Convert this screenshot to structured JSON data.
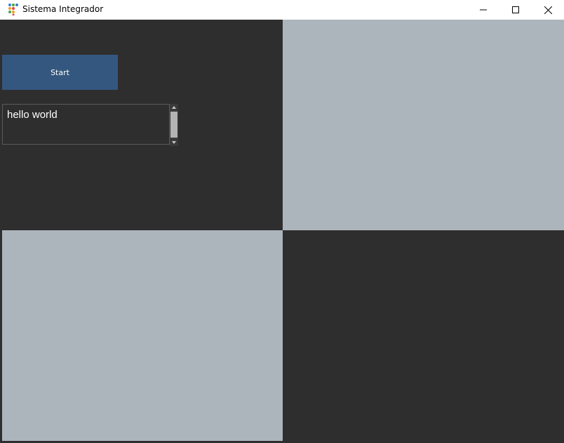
{
  "window": {
    "title": "Sistema Integrador",
    "icon": "app-dots-icon"
  },
  "controls": {
    "minimize_icon": "minimize-icon",
    "maximize_icon": "maximize-icon",
    "close_icon": "close-icon"
  },
  "main": {
    "start_label": "Start",
    "output_text": "hello world"
  },
  "colors": {
    "background_dark": "#2e2e2e",
    "panel_light": "#adb5bc",
    "button_blue": "#34577f",
    "text_white": "#ffffff"
  }
}
